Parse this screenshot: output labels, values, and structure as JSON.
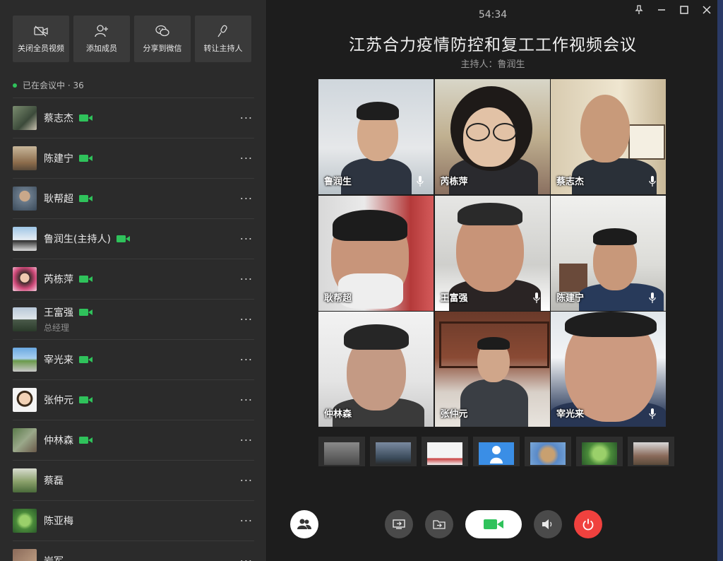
{
  "toolbar": {
    "items": [
      {
        "label": "关闭全员视频",
        "icon": "video-off-icon"
      },
      {
        "label": "添加成员",
        "icon": "add-user-icon"
      },
      {
        "label": "分享到微信",
        "icon": "wechat-icon"
      },
      {
        "label": "转让主持人",
        "icon": "transfer-host-icon"
      }
    ]
  },
  "status": {
    "text": "已在会议中 · 36"
  },
  "members": [
    {
      "name": "蔡志杰",
      "sub": "",
      "camera": true
    },
    {
      "name": "陈建宁",
      "sub": "",
      "camera": true
    },
    {
      "name": "耿帮超",
      "sub": "",
      "camera": true
    },
    {
      "name": "鲁润生(主持人)",
      "sub": "",
      "camera": true
    },
    {
      "name": "芮栋萍",
      "sub": "",
      "camera": true
    },
    {
      "name": "王富强",
      "sub": "总经理",
      "camera": true
    },
    {
      "name": "宰光来",
      "sub": "",
      "camera": true
    },
    {
      "name": "张仲元",
      "sub": "",
      "camera": true
    },
    {
      "name": "仲林森",
      "sub": "",
      "camera": true
    },
    {
      "name": "蔡磊",
      "sub": "",
      "camera": false
    },
    {
      "name": "陈亚梅",
      "sub": "",
      "camera": false
    },
    {
      "name": "岩军",
      "sub": "",
      "camera": false
    }
  ],
  "more_label": "···",
  "meeting": {
    "timer": "54:34",
    "title": "江苏合力疫情防控和复工工作视频会议",
    "host": "主持人：鲁润生"
  },
  "video_tiles": [
    {
      "name": "鲁润生",
      "mic": true
    },
    {
      "name": "芮栋萍",
      "mic": false
    },
    {
      "name": "蔡志杰",
      "mic": true
    },
    {
      "name": "耿帮超",
      "mic": false
    },
    {
      "name": "王富强",
      "mic": true
    },
    {
      "name": "陈建宁",
      "mic": true
    },
    {
      "name": "仲林森",
      "mic": false
    },
    {
      "name": "张仲元",
      "mic": false
    },
    {
      "name": "宰光来",
      "mic": true
    }
  ],
  "colors": {
    "accent_green": "#2fc25b",
    "hangup_red": "#f0413e"
  }
}
